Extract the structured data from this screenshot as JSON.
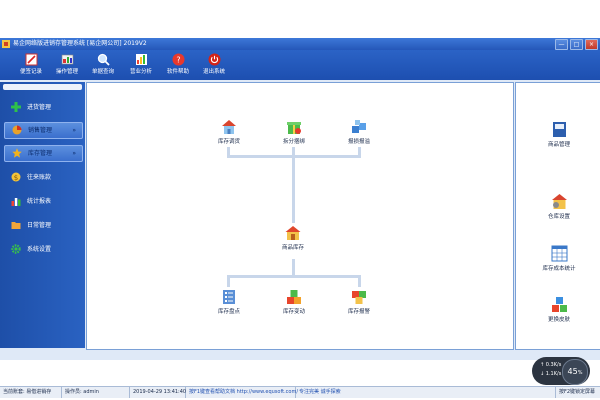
{
  "window": {
    "title": "易企网络版进销存管理系统 [易企网公司] 2019V2",
    "controls": [
      "—",
      "□",
      "×"
    ]
  },
  "toolbar": [
    {
      "label": "便签记录",
      "icon": "notepad-icon"
    },
    {
      "label": "操作管理",
      "icon": "operation-icon"
    },
    {
      "label": "单据查询",
      "icon": "search-icon"
    },
    {
      "label": "营业分析",
      "icon": "chart-icon"
    },
    {
      "label": "软件帮助",
      "icon": "help-icon"
    },
    {
      "label": "退出系统",
      "icon": "power-icon"
    }
  ],
  "sidebar": [
    {
      "label": "进货管理",
      "icon": "plus-icon",
      "active": false
    },
    {
      "label": "销售管理",
      "icon": "pie-icon",
      "active": true,
      "chevron": "»"
    },
    {
      "label": "库存管理",
      "icon": "star-icon",
      "active": true,
      "chevron": "»"
    },
    {
      "label": "往来账款",
      "icon": "money-icon",
      "active": false
    },
    {
      "label": "统计报表",
      "icon": "bars-icon",
      "active": false
    },
    {
      "label": "日常管理",
      "icon": "folder-icon",
      "active": false
    },
    {
      "label": "系统设置",
      "icon": "gear-icon",
      "active": false
    }
  ],
  "flow": {
    "top": [
      {
        "label": "库存调货",
        "icon": "house-transfer-icon"
      },
      {
        "label": "拆分捆绑",
        "icon": "gift-box-icon"
      },
      {
        "label": "报损报溢",
        "icon": "cubes-icon"
      }
    ],
    "center": {
      "label": "商品库存",
      "icon": "warehouse-icon"
    },
    "bottom": [
      {
        "label": "库存盘点",
        "icon": "checklist-icon"
      },
      {
        "label": "库存变动",
        "icon": "boxes-icon"
      },
      {
        "label": "库存报警",
        "icon": "alarm-boxes-icon"
      }
    ]
  },
  "right_panel": [
    {
      "label": "商品管理",
      "icon": "book-icon"
    },
    {
      "label": "仓库设置",
      "icon": "warehouse-settings-icon"
    },
    {
      "label": "库存成本统计",
      "icon": "spreadsheet-icon"
    },
    {
      "label": "更换皮肤",
      "icon": "skin-cubes-icon"
    }
  ],
  "speed_widget": {
    "upload": "0.3K/s",
    "download": "1.1K/s",
    "percent": "45",
    "percent_sign": "%"
  },
  "statusbar": [
    "当前账套: 易借进销存",
    "操作员: admin",
    "2019-04-29 13:41:40",
    "按F1键查看帮助文档 http://www.equsoft.com/",
    "专注完美 诚手探索",
    "按F2键锁定屏幕"
  ]
}
